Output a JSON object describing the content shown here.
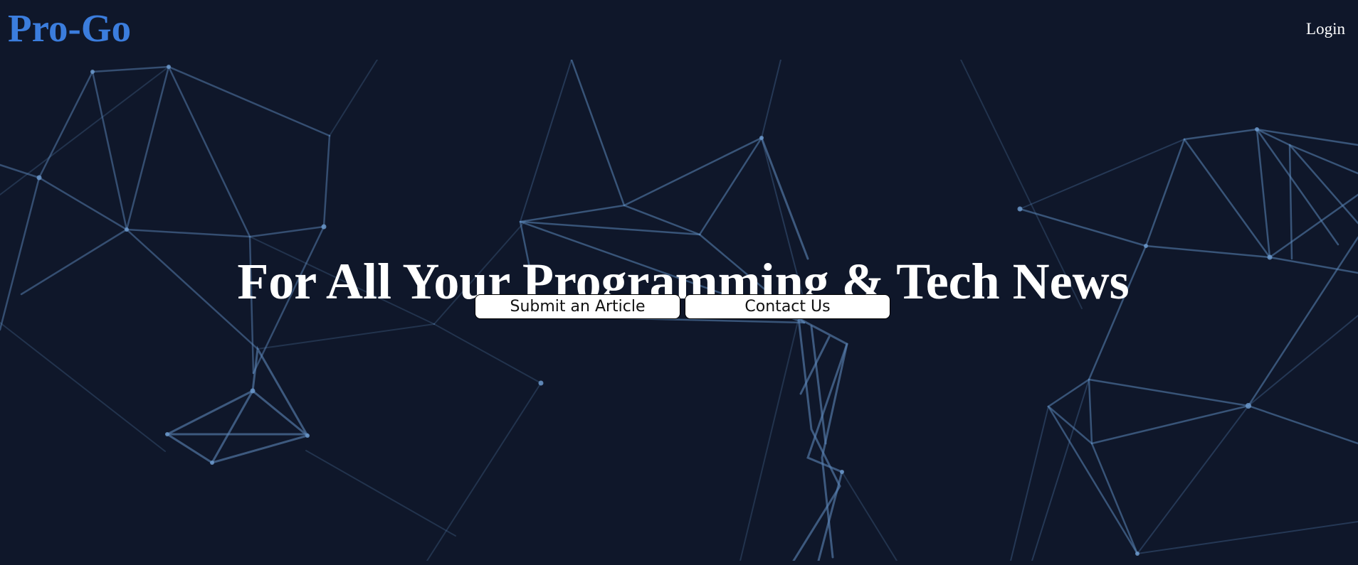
{
  "header": {
    "logo": "Pro-Go",
    "login_label": "Login"
  },
  "hero": {
    "headline": "For All Your Programming & Tech News",
    "buttons": {
      "submit_article": "Submit an Article",
      "contact_us": "Contact Us"
    }
  },
  "colors": {
    "background": "#0f172a",
    "logo": "#3b7ddd",
    "network_lines": "#5b86b8"
  }
}
